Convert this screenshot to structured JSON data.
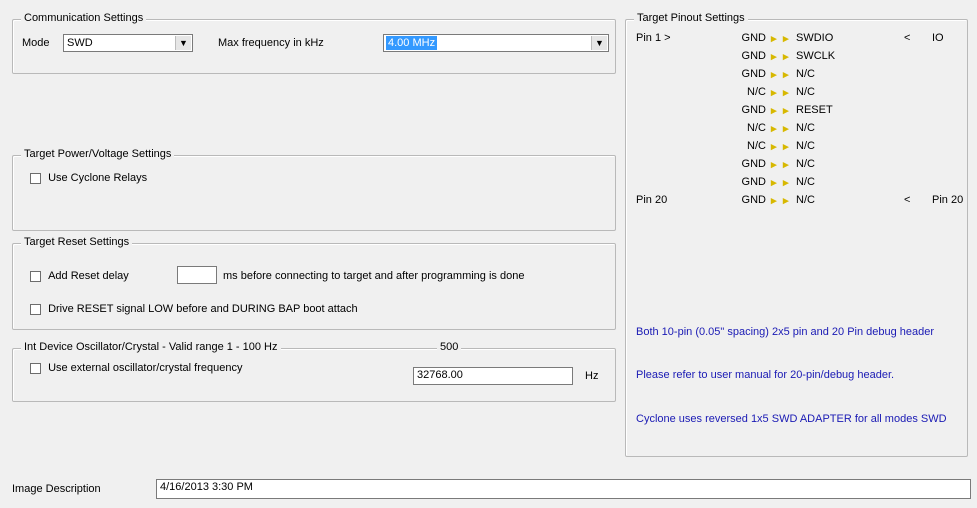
{
  "comm": {
    "legend": "Communication Settings",
    "mode_label": "Mode",
    "mode_value": "SWD",
    "freq_label": "Max frequency in kHz",
    "freq_value": "4.00 MHz"
  },
  "target": {
    "legend": "Target Power/Voltage Settings",
    "unused_label": "Use Cyclone Relays"
  },
  "reset": {
    "legend": "Target Reset Settings",
    "delay_prefix": "Add Reset delay",
    "delay_value": "",
    "delay_suffix": "ms before connecting to target and after programming is done",
    "drive_label": "Drive RESET signal LOW before and DURING BAP boot attach"
  },
  "clock": {
    "legend": "Int Device Oscillator/Crystal - Valid range 1 - 100 Hz",
    "legend_right": "500",
    "use_label": "Use external oscillator/crystal frequency",
    "freq_value": "32768.00",
    "unit": "Hz"
  },
  "pinout": {
    "legend": "Target Pinout Settings",
    "rows": [
      {
        "left": "Pin 1 >",
        "mid": "GND",
        "right": "SWDIO",
        "note": "<",
        "extra": "IO"
      },
      {
        "left": "",
        "mid": "GND",
        "right": "SWCLK",
        "note": "",
        "extra": ""
      },
      {
        "left": "",
        "mid": "GND",
        "right": "N/C",
        "note": "",
        "extra": ""
      },
      {
        "left": "",
        "mid": "N/C",
        "right": "N/C",
        "note": "",
        "extra": ""
      },
      {
        "left": "",
        "mid": "GND",
        "right": "RESET",
        "note": "",
        "extra": ""
      },
      {
        "left": "",
        "mid": "N/C",
        "right": "N/C",
        "note": "",
        "extra": ""
      },
      {
        "left": "",
        "mid": "N/C",
        "right": "N/C",
        "note": "",
        "extra": ""
      },
      {
        "left": "",
        "mid": "GND",
        "right": "N/C",
        "note": "",
        "extra": ""
      },
      {
        "left": "",
        "mid": "GND",
        "right": "N/C",
        "note": "",
        "extra": ""
      },
      {
        "left": "Pin 20",
        "mid": "GND",
        "right": "N/C",
        "note": "<",
        "extra": "Pin 20"
      }
    ],
    "note1": "Both 10-pin (0.05\" spacing) 2x5 pin and 20 Pin debug header",
    "note2": "Please refer to user manual for 20-pin/debug header.",
    "note3": "Cyclone uses reversed 1x5 SWD ADAPTER for all modes SWD"
  },
  "description": {
    "label": "Image Description",
    "value": "4/16/2013 3:30 PM"
  }
}
